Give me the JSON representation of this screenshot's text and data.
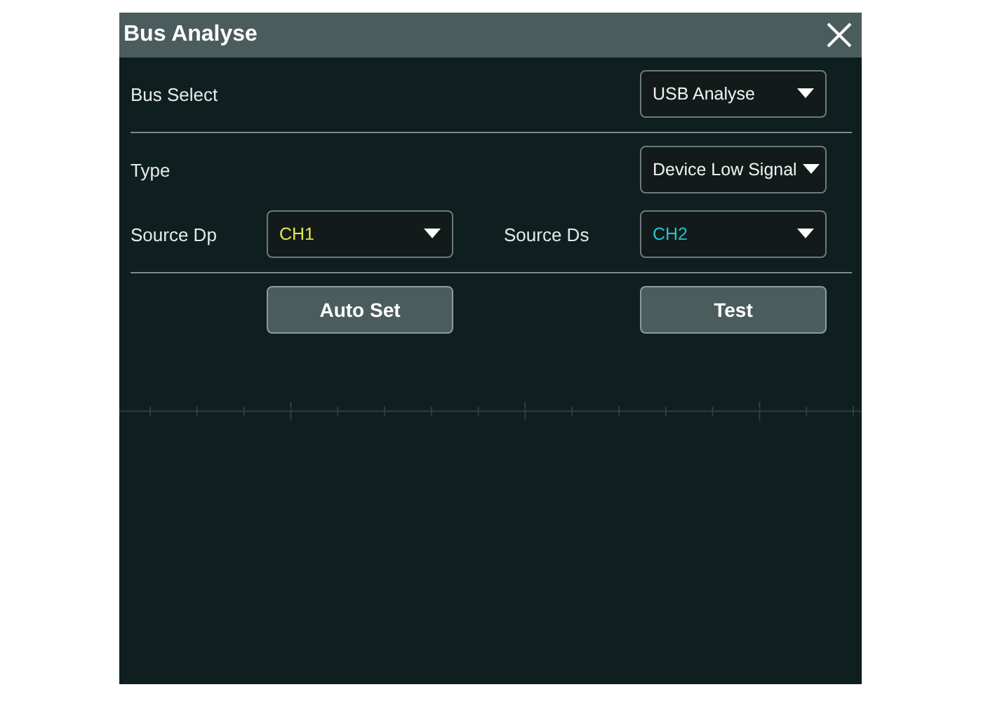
{
  "dialog": {
    "title": "Bus Analyse",
    "sections": [
      {
        "rows": [
          {
            "kind": "setting",
            "label": "Bus Select",
            "value": "USB Analyse"
          }
        ]
      },
      {
        "rows": [
          {
            "kind": "setting",
            "label": "Type",
            "value": "Device Low Signal"
          },
          {
            "kind": "pair",
            "fields": [
              {
                "label": "Source Dp",
                "value": "CH1",
                "color": "#e4e44c"
              },
              {
                "label": "Source Ds",
                "value": "CH2",
                "color": "#22c6cc"
              }
            ]
          }
        ]
      },
      {
        "buttons": [
          "Auto Set",
          "Test"
        ]
      }
    ]
  }
}
